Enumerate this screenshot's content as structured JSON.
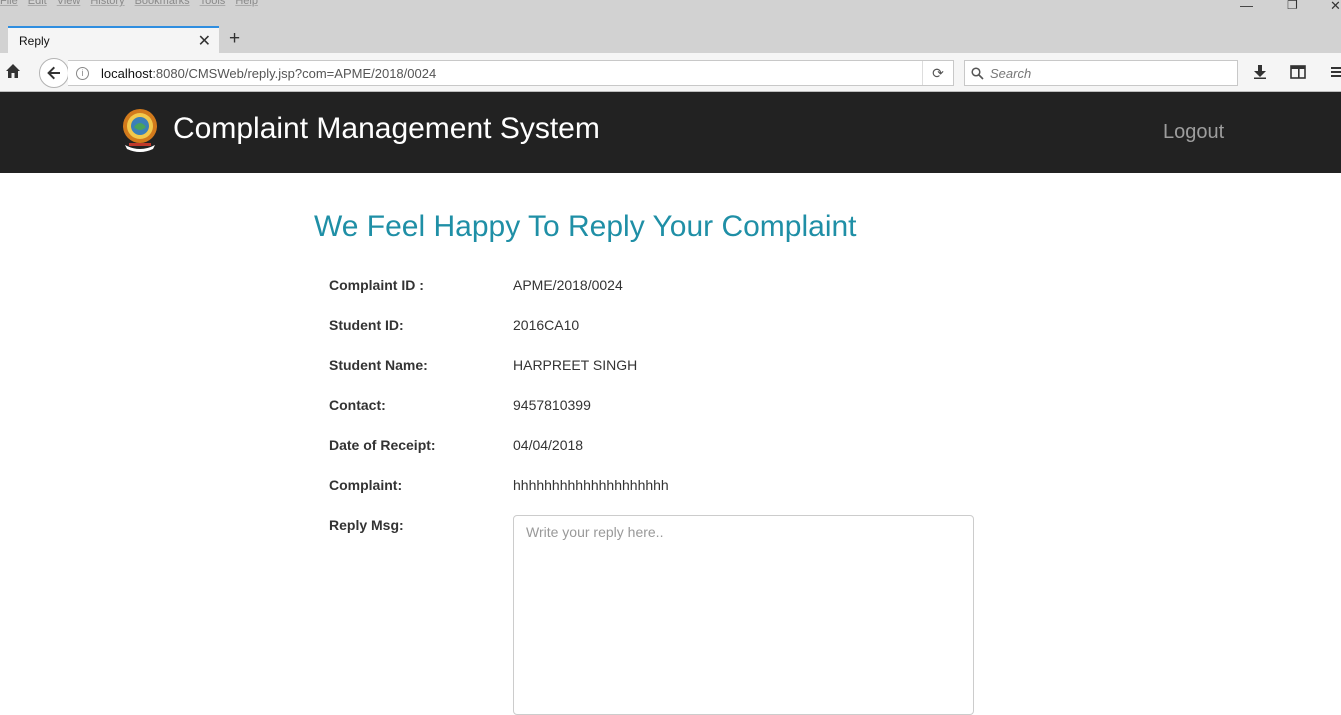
{
  "browser": {
    "menu": [
      "File",
      "Edit",
      "View",
      "History",
      "Bookmarks",
      "Tools",
      "Help"
    ],
    "tab_title": "Reply",
    "url_host": "localhost",
    "url_rest": ":8080/CMSWeb/reply.jsp?com=APME/2018/0024",
    "search_placeholder": "Search"
  },
  "header": {
    "brand": "Complaint Management System",
    "logout": "Logout"
  },
  "main": {
    "heading": "We Feel Happy To Reply Your Complaint",
    "fields": [
      {
        "label": "Complaint ID :",
        "value": "APME/2018/0024"
      },
      {
        "label": "Student ID:",
        "value": "2016CA10"
      },
      {
        "label": "Student Name:",
        "value": "HARPREET SINGH"
      },
      {
        "label": "Contact:",
        "value": "9457810399"
      },
      {
        "label": "Date of Receipt:",
        "value": "04/04/2018"
      },
      {
        "label": "Complaint:",
        "value": "hhhhhhhhhhhhhhhhhhhh"
      }
    ],
    "reply_label": "Reply Msg:",
    "reply_placeholder": "Write your reply here.."
  },
  "colors": {
    "heading": "#1f8fa6",
    "header_bg": "#222222",
    "tab_accent": "#2f8ee0"
  }
}
